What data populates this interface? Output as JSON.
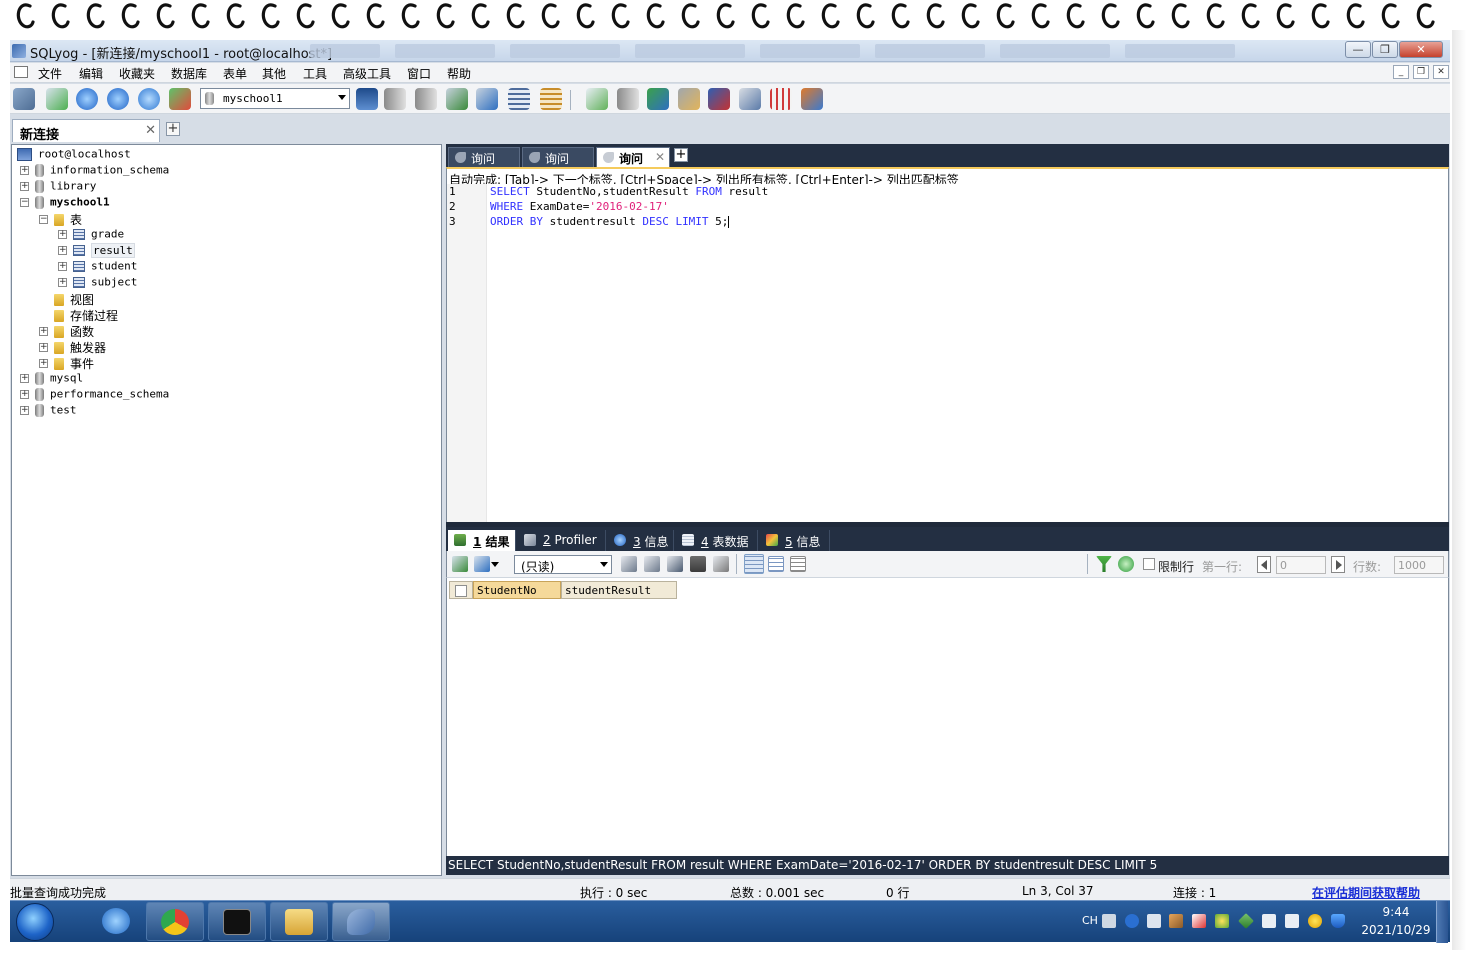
{
  "window": {
    "title": "SQLyog - [新连接/myschool1 - root@localhost*]"
  },
  "menu": {
    "items": [
      "文件",
      "编辑",
      "收藏夹",
      "数据库",
      "表单",
      "其他",
      "工具",
      "高级工具",
      "窗口",
      "帮助"
    ]
  },
  "toolbar": {
    "db_selector_value": "myschool1"
  },
  "connection_tab": {
    "label": "新连接"
  },
  "object_tree": {
    "root": "root@localhost",
    "databases": [
      "information_schema",
      "library",
      "myschool1",
      "mysql",
      "performance_schema",
      "test"
    ],
    "expanded_db": "myschool1",
    "folders": {
      "tables": "表",
      "views": "视图",
      "procedures": "存储过程",
      "functions": "函数",
      "triggers": "触发器",
      "events": "事件"
    },
    "tables": [
      "grade",
      "result",
      "student",
      "subject"
    ]
  },
  "query_tabs": [
    "询问",
    "询问",
    "询问"
  ],
  "editor": {
    "autocomplete_hint": "自动完成: [Tab]-> 下一个标签, [Ctrl+Space]-> 列出所有标签, [Ctrl+Enter]-> 列出匹配标签",
    "line_numbers": [
      "1",
      "2",
      "3"
    ],
    "line1": {
      "kw1": "SELECT",
      "t1": " StudentNo,studentResult ",
      "kw2": "FROM",
      "t2": " result"
    },
    "line2": {
      "kw1": "WHERE",
      "t1": " ExamDate=",
      "str": "'2016-02-17'"
    },
    "line3": {
      "kw1": "ORDER BY",
      "t1": " studentresult ",
      "kw2": "DESC LIMIT",
      "t2": " 5;"
    }
  },
  "result_tabs": [
    {
      "num": "1",
      "label": "结果"
    },
    {
      "num": "2",
      "label": "Profiler"
    },
    {
      "num": "3",
      "label": "信息"
    },
    {
      "num": "4",
      "label": "表数据"
    },
    {
      "num": "5",
      "label": "信息"
    }
  ],
  "result_toolbar": {
    "readonly_value": "(只读)",
    "limit_rows_label": "限制行",
    "first_row_label": "第一行:",
    "first_row_value": "0",
    "row_count_label": "行数:",
    "row_count_value": "1000"
  },
  "grid": {
    "columns": [
      "StudentNo",
      "studentResult"
    ]
  },
  "sql_bar": {
    "text": "SELECT StudentNo,studentResult FROM result WHERE ExamDate='2016-02-17' ORDER BY studentresult DESC LIMIT 5"
  },
  "status": {
    "message": "批量查询成功完成",
    "exec": "执行 : 0 sec",
    "total": "总数 : 0.001 sec",
    "rows": "0 行",
    "position": "Ln 3, Col 37",
    "connections": "连接 : 1",
    "help_link": "在评估期间获取帮助"
  },
  "taskbar": {
    "lang": "CH",
    "time": "9:44",
    "date": "2021/10/29"
  },
  "colors": {
    "keyword": "#3232ff",
    "string": "#e0207a",
    "panel_dark": "#232f42"
  }
}
